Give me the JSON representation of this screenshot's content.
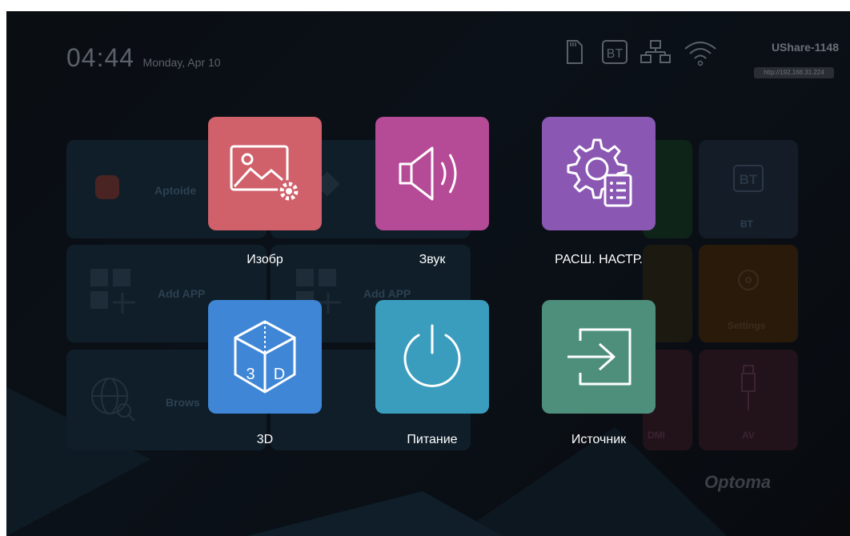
{
  "status_bar": {
    "time": "04:44",
    "date": "Monday, Apr 10",
    "device_name": "UShare-1148",
    "device_url": "http://192.168.31.224",
    "bt_label": "BT",
    "icons": [
      "sd-card-icon",
      "bluetooth-icon",
      "ethernet-icon",
      "wifi-icon"
    ]
  },
  "background_tiles": {
    "aptoide": "Aptoide",
    "add_app_1": "Add APP",
    "add_app_2": "Add APP",
    "browser": "Brows",
    "bt": "BT",
    "settings": "Settings",
    "hdmi": "DMI",
    "av": "AV"
  },
  "menu": {
    "items": [
      {
        "label": "Изобр",
        "icon": "picture-settings-icon",
        "color": "#d0606a"
      },
      {
        "label": "Звук",
        "icon": "speaker-icon",
        "color": "#b54a96"
      },
      {
        "label": "РАСШ. НАСТР.",
        "icon": "advanced-settings-icon",
        "color": "#8a58b3"
      },
      {
        "label": "3D",
        "icon": "3d-cube-icon",
        "color": "#3f86d6"
      },
      {
        "label": "Питание",
        "icon": "power-icon",
        "color": "#3a9dbd"
      },
      {
        "label": "Источник",
        "icon": "input-source-icon",
        "color": "#4e8f7b"
      }
    ]
  },
  "brand": "Optoma"
}
